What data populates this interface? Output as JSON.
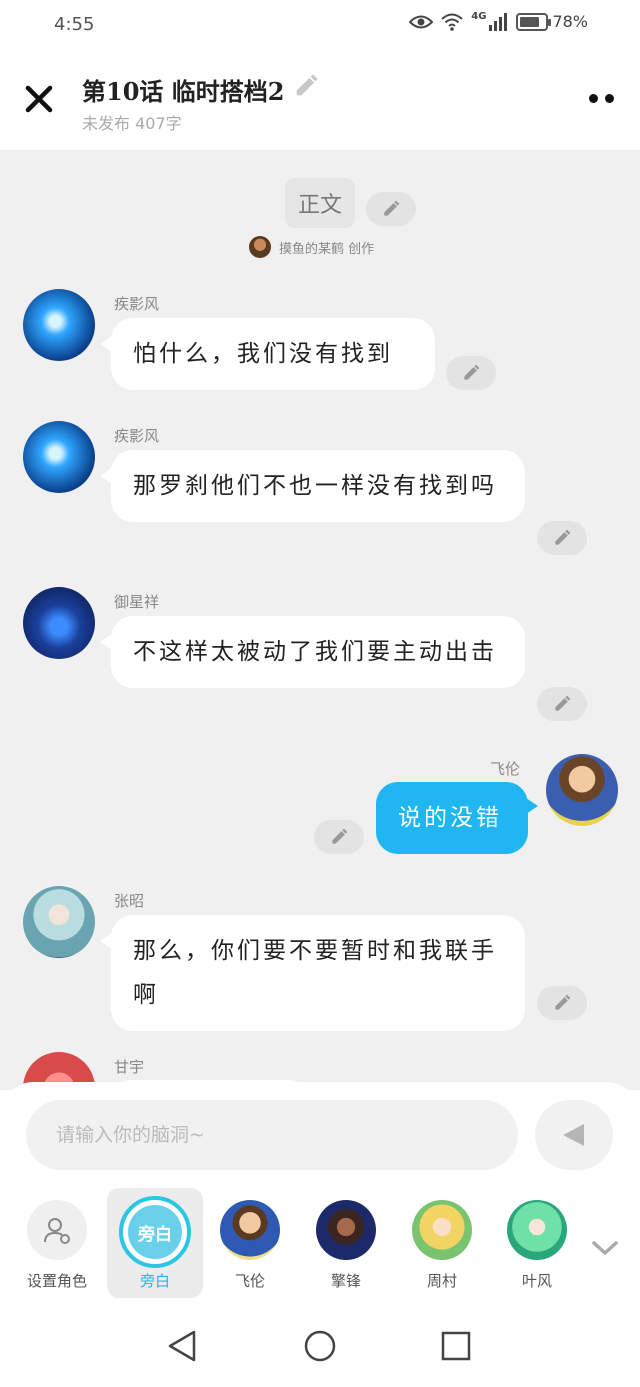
{
  "status_bar": {
    "time": "4:55",
    "network": "4G",
    "battery": "78%",
    "battery_level": 0.78
  },
  "header": {
    "title": "第10话  临时搭档2",
    "subtitle": "未发布 407字"
  },
  "chat": {
    "section_label": "正文",
    "author_credit": "摸鱼的某鹤 创作",
    "messages": [
      {
        "speaker": "疾影风",
        "text": "怕什么，我们没有找到",
        "side": "left"
      },
      {
        "speaker": "疾影风",
        "text": "那罗刹他们不也一样没有找到吗",
        "side": "left"
      },
      {
        "speaker": "御星祥",
        "text": "不这样太被动了我们要主动出击",
        "side": "left"
      },
      {
        "speaker": "飞伦",
        "text": "说的没错",
        "side": "right"
      },
      {
        "speaker": "张昭",
        "text": "那么，你们要不要暂时和我联手啊",
        "side": "left"
      },
      {
        "speaker": "甘宇",
        "text": "",
        "side": "left"
      }
    ]
  },
  "composer": {
    "placeholder": "请输入你的脑洞~",
    "narrator_badge": "旁白",
    "roles": [
      {
        "label": "设置角色",
        "icon": "add-role-icon"
      },
      {
        "label": "旁白",
        "active": true
      },
      {
        "label": "飞伦"
      },
      {
        "label": "擎锋"
      },
      {
        "label": "周村"
      },
      {
        "label": "叶风"
      }
    ]
  },
  "colors": {
    "accent": "#1fb6f1",
    "background": "#f0f0f0",
    "bubble": "#ffffff"
  }
}
